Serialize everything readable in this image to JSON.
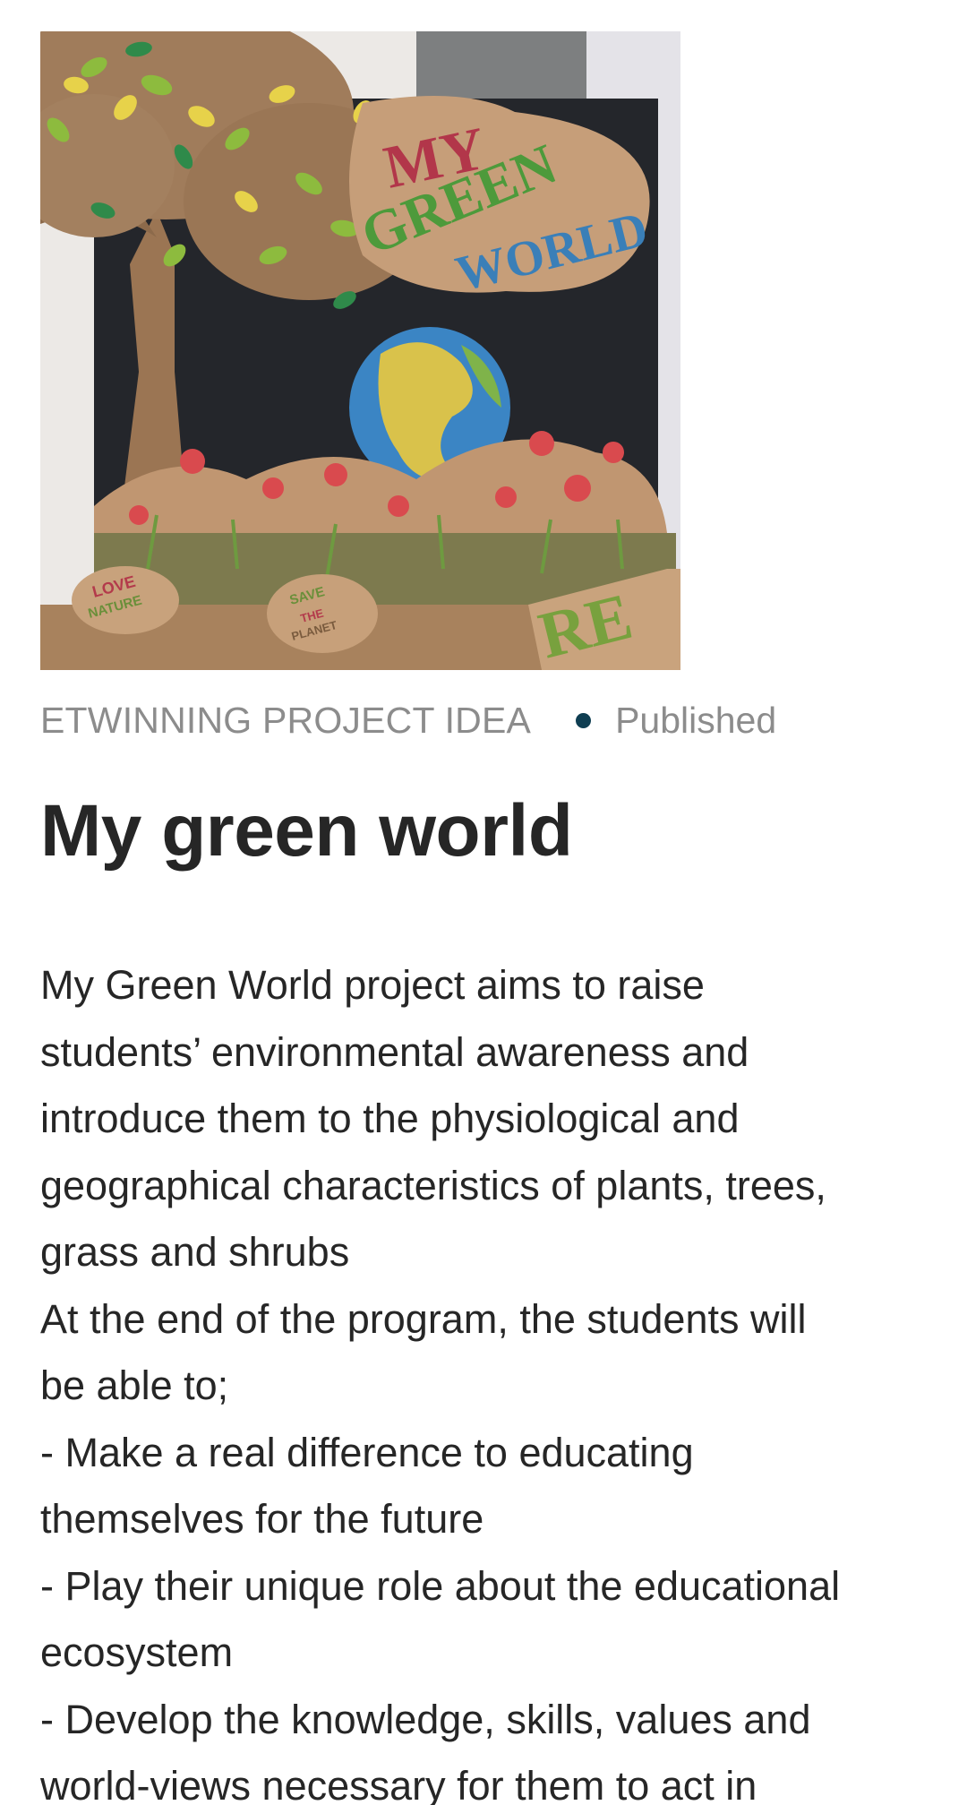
{
  "article": {
    "hero_image_alt": "My green world",
    "hero_image_lettering": [
      "MY",
      "GREEN",
      "WORLD",
      "LOVE NATURE",
      "SAVE THE PLANET",
      "RE"
    ],
    "type_label": "ETWINNING PROJECT IDEA",
    "status_label": "Published",
    "title": "My green world",
    "body_lines": [
      "My Green World project aims to raise",
      "students’ environmental awareness and",
      "introduce them to the physiological and",
      "geographical characteristics of plants, trees,",
      "grass and shrubs",
      "At the end of the program, the students will",
      "be able to;",
      "- Make a real difference to educating",
      "themselves for the future",
      "- Play their unique role about the educational",
      "ecosystem",
      "- Develop the knowledge, skills, values and",
      "world-views necessary for them to act in"
    ]
  },
  "colors": {
    "title": "#262626",
    "meta": "#8c8c8c",
    "status_dot": "#0f3e52"
  }
}
